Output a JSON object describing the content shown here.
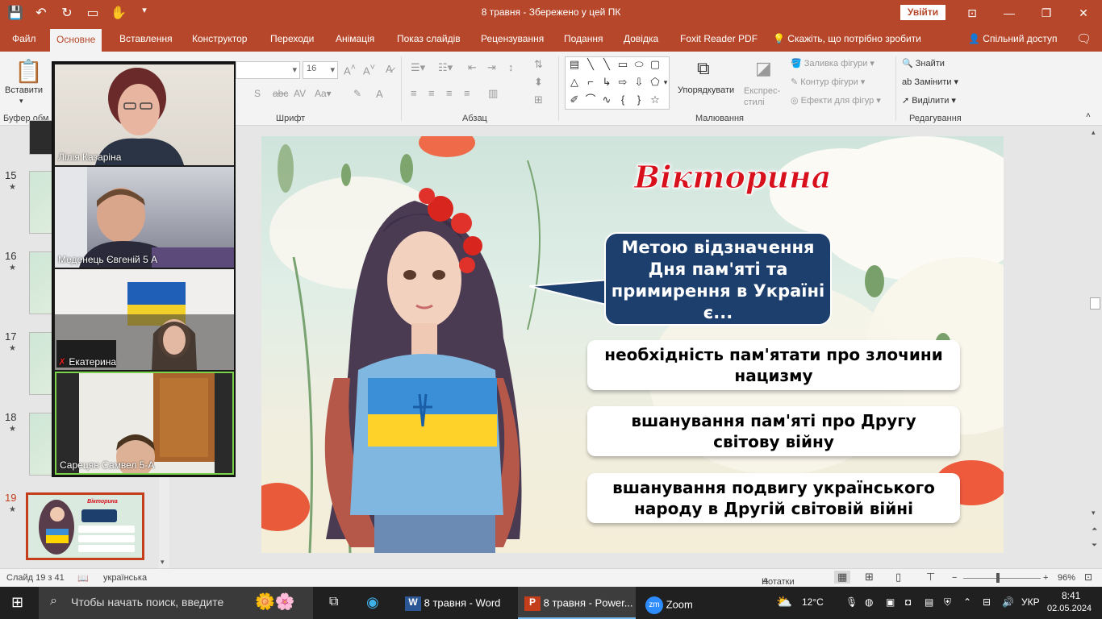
{
  "titlebar": {
    "doc_title": "8 травня  -  Збережено у цей ПК",
    "signin": "Увійти"
  },
  "tabs": [
    "Файл",
    "Основне",
    "Вставлення",
    "Конструктор",
    "Переходи",
    "Анімація",
    "Показ слайдів",
    "Рецензування",
    "Подання",
    "Довідка",
    "Foxit Reader PDF"
  ],
  "tell_me": "Скажіть, що потрібно зробити",
  "share": "Спільний доступ",
  "ribbon": {
    "paste": "Вставити",
    "clipboard_group": "Буфер обм",
    "font_size": "16",
    "font_group": "Шрифт",
    "paragraph_group": "Абзац",
    "arrange": "Упорядкувати",
    "quick_styles": "Експрес-стилі",
    "shape_fill": "Заливка фігури",
    "shape_outline": "Контур фігури",
    "shape_effects": "Ефекти для фігур",
    "drawing_group": "Малювання",
    "find": "Знайти",
    "replace": "Замінити",
    "select": "Виділити",
    "editing_group": "Редагування"
  },
  "slides_panel": {
    "items": [
      {
        "num": "15"
      },
      {
        "num": "16"
      },
      {
        "num": "17"
      },
      {
        "num": "18"
      },
      {
        "num": "19"
      }
    ]
  },
  "zoom": {
    "participants": [
      {
        "name": "Лілія Казаріна"
      },
      {
        "name": "Меденець Євгеній 5 А"
      },
      {
        "name": "Екатерина"
      },
      {
        "name": "Сарецян Самвел 5-А"
      }
    ]
  },
  "slide": {
    "title": "Вікторина",
    "question": "Метою відзначення Дня пам'яті та примирення в Україні є...",
    "answers": [
      "необхідність пам'ятати про злочини нацизму",
      "вшанування пам'яті про Другу світову війну",
      "вшанування подвигу українського народу в Другій світовій війні"
    ]
  },
  "status": {
    "slide_counter": "Слайд 19 з 41",
    "language": "українська",
    "notes": "Нотатки",
    "zoom": "96%"
  },
  "taskbar": {
    "search_placeholder": "Чтобы начать поиск, введите",
    "apps": [
      {
        "label": "8 травня - Word"
      },
      {
        "label": "8 травня - Power..."
      },
      {
        "label": "Zoom"
      }
    ],
    "weather": "12°C",
    "lang": "УКР",
    "time": "8:41",
    "date": "02.05.2024"
  },
  "colors": {
    "accent": "#b7472a",
    "bubble": "#1d3f6e",
    "title_red": "#d7101b"
  }
}
